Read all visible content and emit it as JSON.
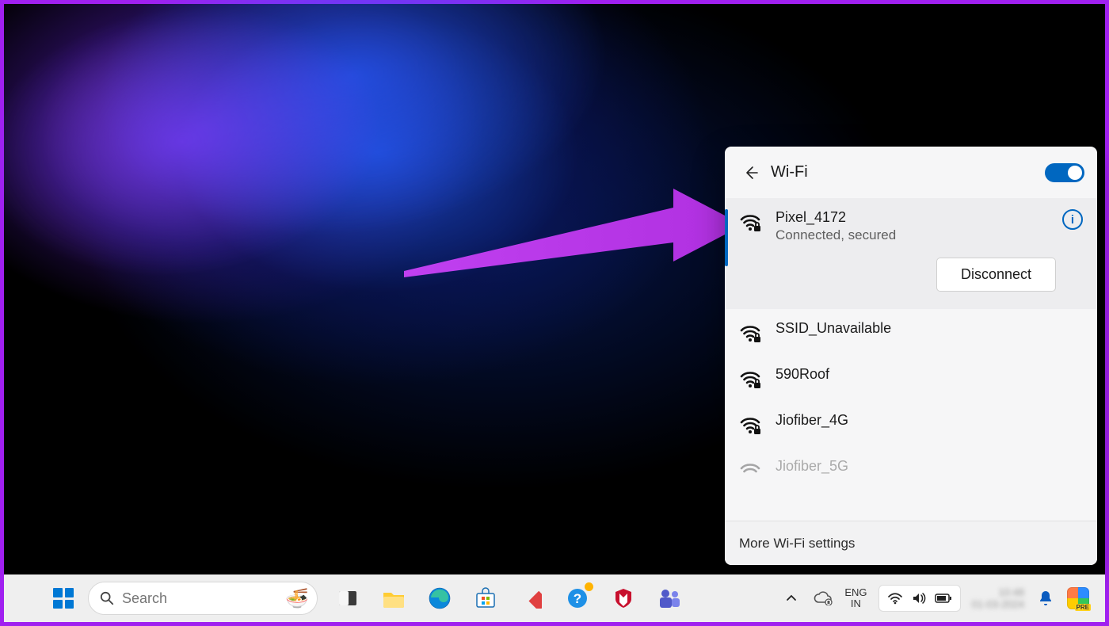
{
  "flyout": {
    "title": "Wi-Fi",
    "toggle_on": true,
    "footer": "More Wi-Fi settings",
    "connected": {
      "name": "Pixel_4172",
      "status": "Connected, secured",
      "disconnect_label": "Disconnect"
    },
    "networks": [
      {
        "name": "SSID_Unavailable"
      },
      {
        "name": "590Roof"
      },
      {
        "name": "Jiofiber_4G"
      },
      {
        "name": "Jiofiber_5G"
      }
    ]
  },
  "taskbar": {
    "search_placeholder": "Search",
    "lang_top": "ENG",
    "lang_bot": "IN",
    "time": "10:48",
    "date": "01-03-2024",
    "pre_badge": "PRE"
  }
}
